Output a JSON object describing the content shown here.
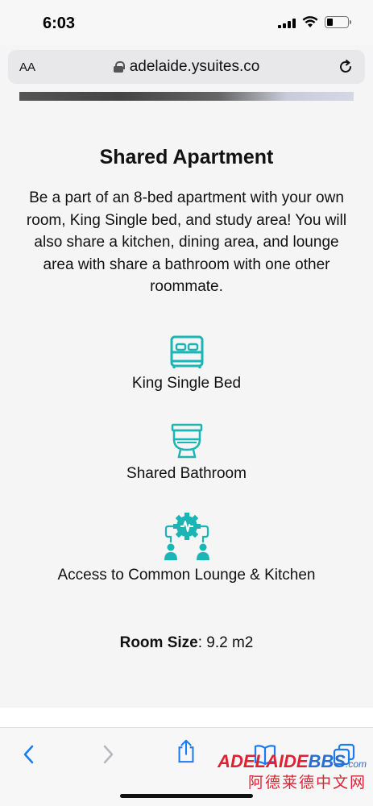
{
  "status_bar": {
    "time": "6:03",
    "icons": [
      "cellular-signal-icon",
      "wifi-icon",
      "battery-icon"
    ]
  },
  "browser": {
    "text_size_label": "AA",
    "url": "adelaide.ysuites.co",
    "icons": [
      "lock-icon",
      "reload-icon"
    ]
  },
  "room": {
    "title": "Shared Apartment",
    "description": "Be a part of an 8-bed apartment with your own room, King Single bed, and study area! You will also share a kitchen, dining area, and lounge area with share a bathroom with one other roommate.",
    "features": [
      {
        "label": "King Single Bed",
        "icon": "bed-icon"
      },
      {
        "label": "Shared Bathroom",
        "icon": "toilet-icon"
      },
      {
        "label": "Access to Common Lounge & Kitchen",
        "icon": "lounge-gear-people-icon"
      }
    ],
    "room_size_label": "Room Size",
    "room_size_value": ": 9.2 m2"
  },
  "toolbar": {
    "icons": [
      "back-icon",
      "forward-icon",
      "share-icon",
      "bookmarks-icon",
      "tabs-icon"
    ]
  },
  "watermark": {
    "brand_part1": "ADELAIDE",
    "brand_part2": "BBS",
    "brand_suffix": ".com",
    "subtitle": "阿德莱德中文网"
  },
  "colors": {
    "accent_teal": "#1cb5b5",
    "toolbar_blue": "#1a7cf5",
    "background": "#f5f5f5"
  }
}
